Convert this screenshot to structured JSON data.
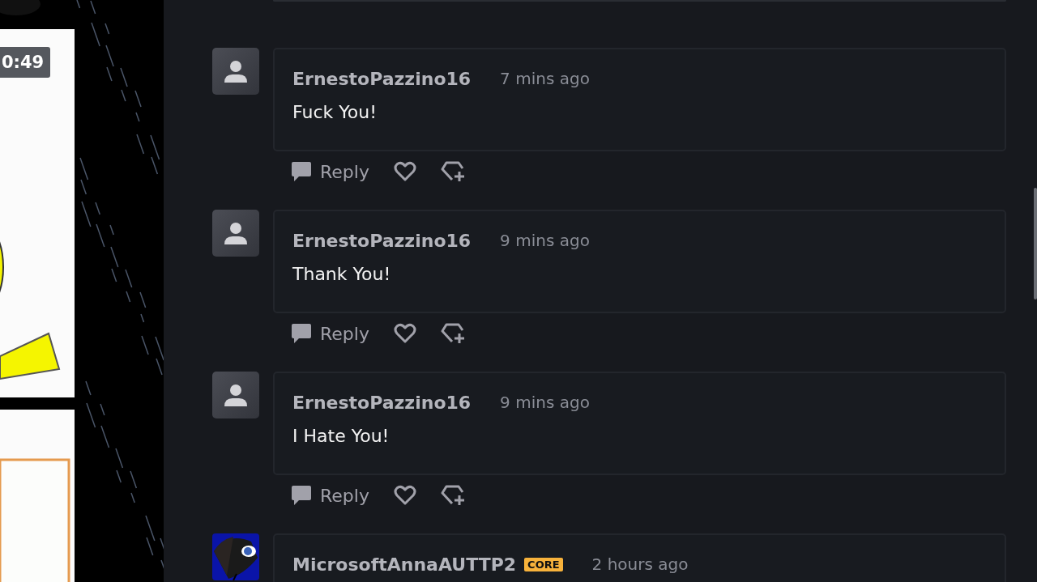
{
  "thumbnail": {
    "duration": "0:49"
  },
  "comments": [
    {
      "kind": "default",
      "author": "ErnestoPazzino16",
      "time": "7 mins ago",
      "text": "Fuck You!",
      "reply": "Reply"
    },
    {
      "kind": "default",
      "author": "ErnestoPazzino16",
      "time": "9 mins ago",
      "text": "Thank You!",
      "reply": "Reply"
    },
    {
      "kind": "default",
      "author": "ErnestoPazzino16",
      "time": "9 mins ago",
      "text": "I Hate You!",
      "reply": "Reply"
    },
    {
      "kind": "picture",
      "author": "MicrosoftAnnaAUTTP2",
      "badge": "CORE",
      "time": "2 hours ago"
    }
  ]
}
